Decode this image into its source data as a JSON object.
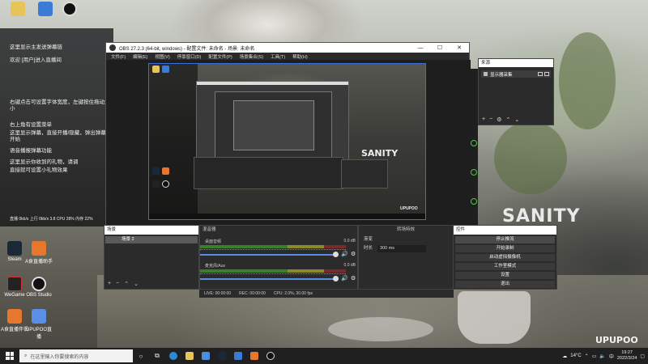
{
  "colors": {
    "obs_bg": "#2b2b2b",
    "preview_border": "#3a6fd8",
    "taskbar": "#202020"
  },
  "wallpaper": {
    "sanity": "SANITY",
    "upupoo": "UPUPOO"
  },
  "left_panel": {
    "lines": [
      "这里显示主发送弹幕链",
      "欢迎 [用户]进入直播间",
      "",
      "",
      "右键点击可设置字体宽度，左键按住拖动大小",
      "",
      "右上角有设置菜单",
      "这里显示弹幕，直接开播/隐藏，弹出弹幕开始",
      "语音播报弹幕功能",
      "",
      "这里显示你收到的礼物，请调",
      "直接就可设置小礼物效果"
    ],
    "footer": "直播 0kb/s 上行 0kb/s 3.8   CPU 28%  内存 22%"
  },
  "desktop_icons": [
    {
      "label": "Steam",
      "icon": "steam-icon",
      "color": "#1b2838"
    },
    {
      "label": "A食直播助手",
      "icon": "app-icon",
      "color": "#e8772e"
    },
    {
      "label": "WeGame",
      "icon": "wegame-icon",
      "color": "#222222"
    },
    {
      "label": "OBS Studio",
      "icon": "obs-icon",
      "color": "#111111"
    },
    {
      "label": "A食直播伴侣",
      "icon": "app-icon",
      "color": "#e8772e"
    },
    {
      "label": "UPUPOO直播",
      "icon": "app-icon",
      "color": "#5a8fe6"
    }
  ],
  "obs": {
    "title": "OBS 27.2.3 (64-bit, windows) - 配置文件: 未命名 - 场景: 未命名",
    "menu": [
      "文件(F)",
      "编辑(E)",
      "视图(V)",
      "停靠窗口(D)",
      "配置文件(P)",
      "场景集合(S)",
      "工具(T)",
      "帮助(H)"
    ],
    "nest_sanity": "SANITY",
    "nest_upupoo": "UPUPOO",
    "sources": {
      "title": "来源",
      "item": "显示器采集"
    },
    "scenes": {
      "title": "场景",
      "item": "场景 2"
    },
    "mixer": {
      "title": "混音器",
      "channels": [
        {
          "name": "桌面音频",
          "db": "0.0 dB"
        },
        {
          "name": "麦克风/Aux",
          "db": "0.0 dB"
        }
      ]
    },
    "transitions": {
      "title": "转场特效",
      "mode": "渐变",
      "duration_label": "时长",
      "duration_value": "300 ms"
    },
    "controls": {
      "title": "控件",
      "buttons": [
        "停止推流",
        "开始录制",
        "启动虚拟摄像机",
        "工作室模式",
        "设置",
        "退出"
      ]
    },
    "status": [
      "LIVE: 00:00:00",
      "REC: 00:00:00",
      "CPU: 2.0%, 30.00 fps"
    ]
  },
  "taskbar": {
    "search_placeholder": "在这里输入你要搜索的内容",
    "weather": "14°C",
    "time": "19:27",
    "date": "2022/3/24"
  }
}
